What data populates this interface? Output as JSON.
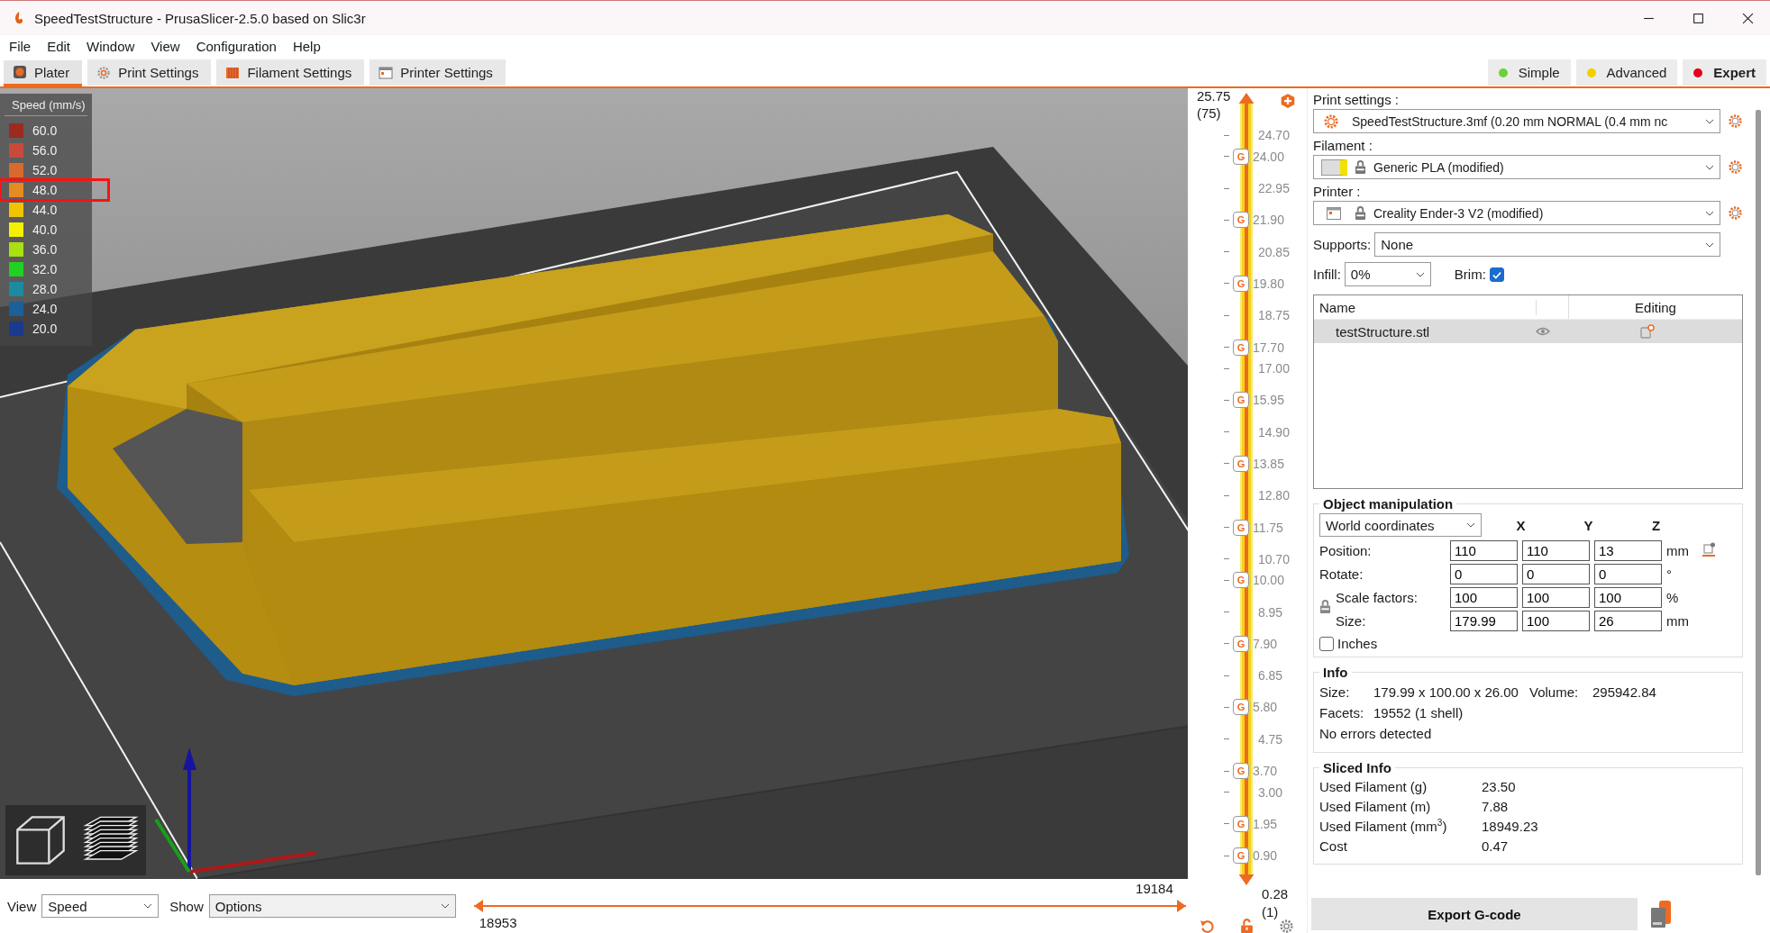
{
  "window": {
    "title": "SpeedTestStructure - PrusaSlicer-2.5.0 based on Slic3r"
  },
  "menu": [
    "File",
    "Edit",
    "Window",
    "View",
    "Configuration",
    "Help"
  ],
  "tabs": [
    {
      "label": "Plater",
      "selected": true
    },
    {
      "label": "Print Settings",
      "selected": false
    },
    {
      "label": "Filament Settings",
      "selected": false
    },
    {
      "label": "Printer Settings",
      "selected": false
    }
  ],
  "modes": [
    {
      "label": "Simple",
      "color": "#6bd13a",
      "selected": false
    },
    {
      "label": "Advanced",
      "color": "#f2d000",
      "selected": false
    },
    {
      "label": "Expert",
      "color": "#e2001a",
      "selected": true
    }
  ],
  "legend": {
    "title": "Speed (mm/s)",
    "items": [
      {
        "label": "60.0",
        "color": "#9b2a1f",
        "highlighted": false
      },
      {
        "label": "56.0",
        "color": "#c84a3a",
        "highlighted": false
      },
      {
        "label": "52.0",
        "color": "#d86a2e",
        "highlighted": false
      },
      {
        "label": "48.0",
        "color": "#e68a22",
        "highlighted": true
      },
      {
        "label": "44.0",
        "color": "#f0c400",
        "highlighted": false
      },
      {
        "label": "40.0",
        "color": "#f5f000",
        "highlighted": false
      },
      {
        "label": "36.0",
        "color": "#a8e010",
        "highlighted": false
      },
      {
        "label": "32.0",
        "color": "#22d022",
        "highlighted": false
      },
      {
        "label": "28.0",
        "color": "#1c8aa0",
        "highlighted": false
      },
      {
        "label": "24.0",
        "color": "#1b6098",
        "highlighted": false
      },
      {
        "label": "20.0",
        "color": "#1a3a8e",
        "highlighted": false
      }
    ]
  },
  "layer_slider": {
    "level": 1,
    "top_value": "25.75",
    "top_layer": "(75)",
    "bottom_value": "0.28",
    "bottom_layer": "(1)",
    "ticks": [
      {
        "label": "24.70"
      },
      {
        "label": "24.00",
        "marker": "G"
      },
      {
        "label": "22.95"
      },
      {
        "label": "21.90",
        "marker": "G"
      },
      {
        "label": "20.85"
      },
      {
        "label": "19.80",
        "marker": "G"
      },
      {
        "label": "18.75"
      },
      {
        "label": "17.70",
        "marker": "G"
      },
      {
        "label": "17.00"
      },
      {
        "label": "15.95",
        "marker": "G"
      },
      {
        "label": "14.90"
      },
      {
        "label": "13.85",
        "marker": "G"
      },
      {
        "label": "12.80"
      },
      {
        "label": "11.75",
        "marker": "G"
      },
      {
        "label": "10.70"
      },
      {
        "label": "10.00",
        "marker": "G"
      },
      {
        "label": "8.95"
      },
      {
        "label": "7.90",
        "marker": "G"
      },
      {
        "label": "6.85"
      },
      {
        "label": "5.80",
        "marker": "G"
      },
      {
        "label": "4.75"
      },
      {
        "label": "3.70",
        "marker": "G"
      },
      {
        "label": "3.00"
      },
      {
        "label": "1.95",
        "marker": "G"
      },
      {
        "label": "0.90",
        "marker": "G"
      }
    ]
  },
  "view_bar": {
    "view_label": "View",
    "view": "Speed",
    "show_label": "Show",
    "show": "Options"
  },
  "move_slider": {
    "level": 1,
    "upper": "19184",
    "lower": "18953"
  },
  "sidebar": {
    "print_settings_label": "Print settings :",
    "print_settings": "SpeedTestStructure.3mf (0.20 mm NORMAL (0.4 mm nc",
    "filament_label": "Filament :",
    "filament": "Generic PLA (modified)",
    "printer_label": "Printer :",
    "printer": "Creality Ender-3 V2 (modified)",
    "supports_label": "Supports:",
    "supports": "None",
    "infill_label": "Infill:",
    "infill": "0%",
    "brim_label": "Brim:",
    "brim": true,
    "object_list": {
      "columns": [
        "Name",
        "Editing"
      ],
      "rows": [
        {
          "name": "testStructure.stl",
          "selected": true
        }
      ]
    },
    "object_manipulation": {
      "title": "Object manipulation",
      "coordinates": "World coordinates",
      "axes": [
        "X",
        "Y",
        "Z"
      ],
      "rows": [
        {
          "label": "Position:",
          "values": [
            "110",
            "110",
            "13"
          ],
          "unit": "mm"
        },
        {
          "label": "Rotate:",
          "values": [
            "0",
            "0",
            "0"
          ],
          "unit": "°"
        },
        {
          "label": "Scale factors:",
          "values": [
            "100",
            "100",
            "100"
          ],
          "unit": "%"
        },
        {
          "label": "Size:",
          "values": [
            "179.99",
            "100",
            "26"
          ],
          "unit": "mm"
        }
      ],
      "inches": {
        "label": "Inches",
        "checked": false
      }
    },
    "info": {
      "title": "Info",
      "size_label": "Size:",
      "size": "179.99 x 100.00 x 26.00",
      "volume_label": "Volume:",
      "volume": "295942.84",
      "facets_label": "Facets:",
      "facets": "19552 (1 shell)",
      "status": "No errors detected"
    },
    "sliced_info": {
      "title": "Sliced Info",
      "rows": [
        {
          "label": "Used Filament (g)",
          "value": "23.50"
        },
        {
          "label": "Used Filament (m)",
          "value": "7.88"
        },
        {
          "label": "Used Filament (mm$^{3}$)",
          "value": "18949.23"
        },
        {
          "label": "Cost",
          "value": "0.47"
        }
      ]
    },
    "export_button": "Export G-code"
  }
}
